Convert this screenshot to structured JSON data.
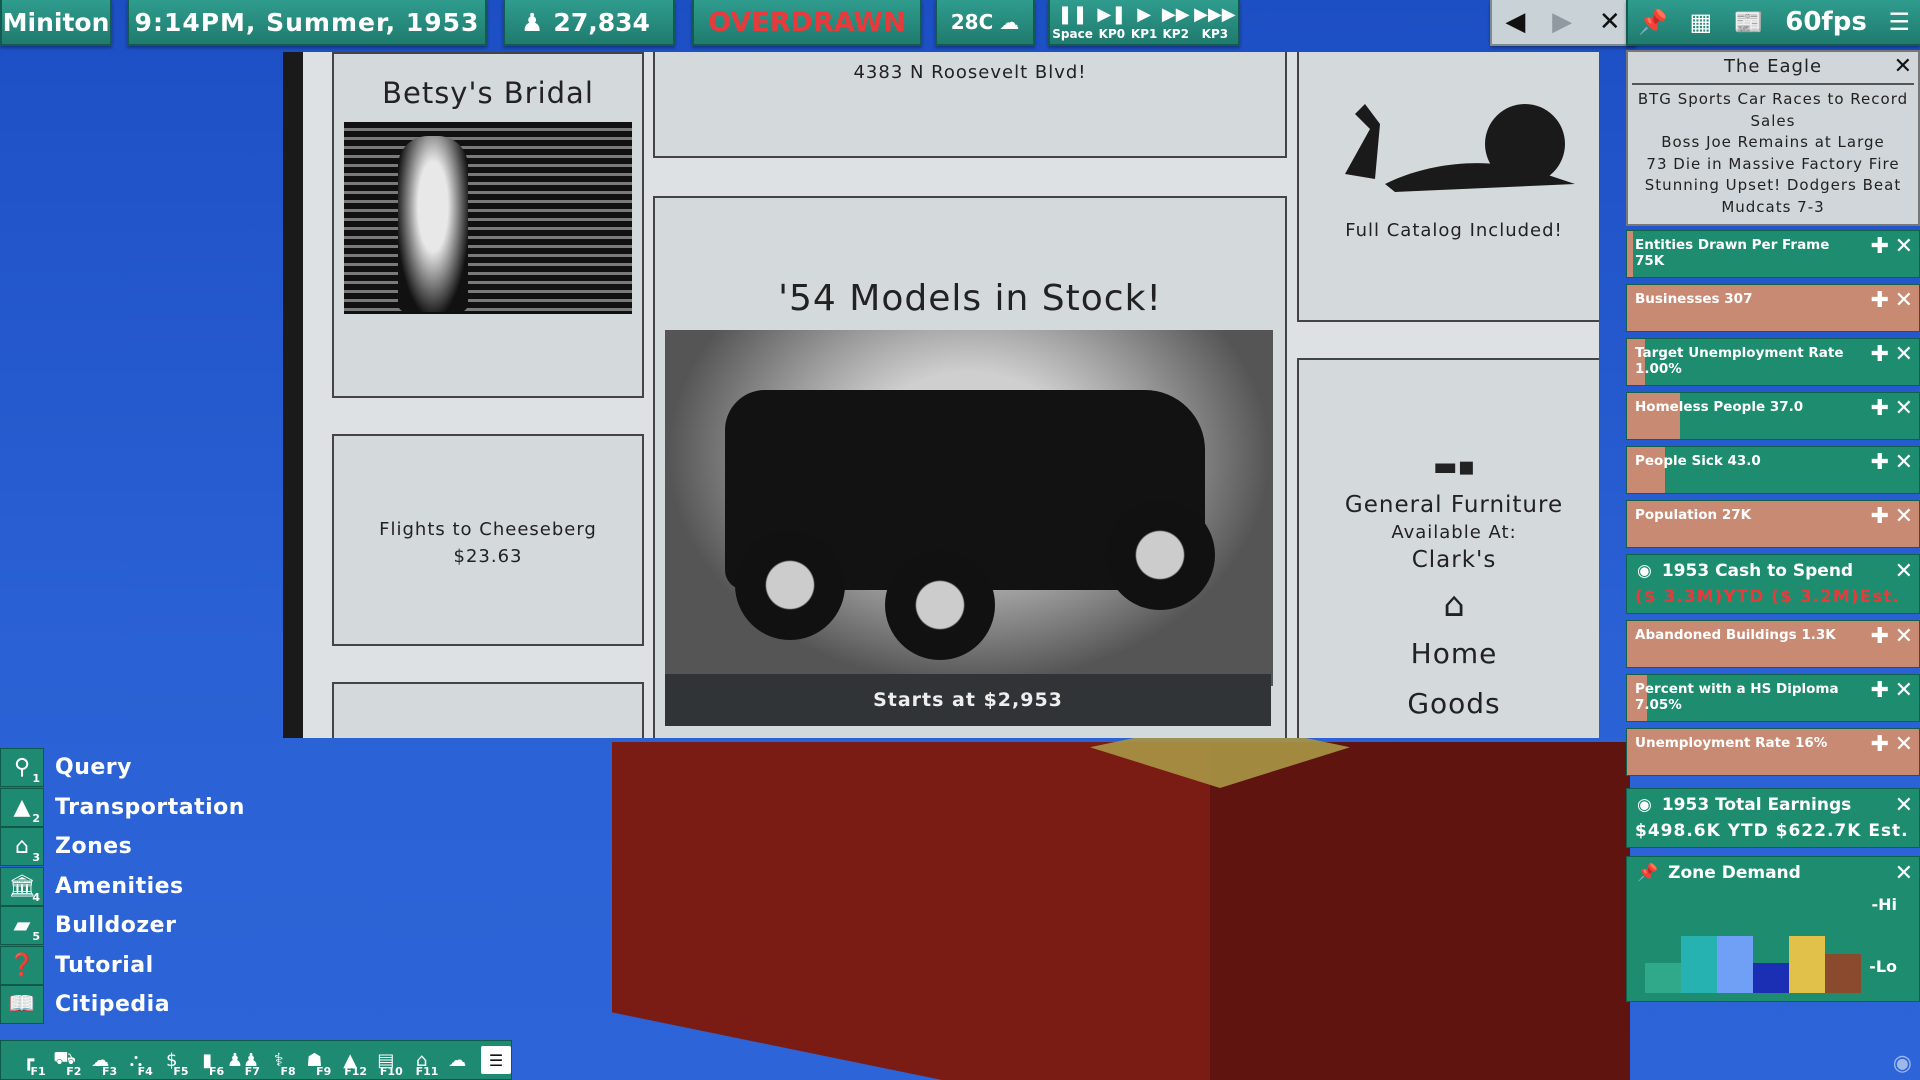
{
  "topbar": {
    "city": "Miniton",
    "datetime": "9:14PM, Summer, 1953",
    "population": "27,834",
    "money_status": "OVERDRAWN",
    "money_status_color": "#e83a3a",
    "temperature": "28C",
    "weather_icon": "rain-cloud-icon",
    "speed_controls": [
      {
        "label": "Space",
        "icon": "pause-icon"
      },
      {
        "label": "KP0",
        "icon": "play-slow-icon"
      },
      {
        "label": "KP1",
        "icon": "play-icon"
      },
      {
        "label": "KP2",
        "icon": "fast-forward-icon"
      },
      {
        "label": "KP3",
        "icon": "fastest-forward-icon"
      }
    ],
    "fps": "60fps"
  },
  "newspaper": {
    "bridal_title": "Betsy's Bridal",
    "flights_line1": "Flights to Cheeseberg",
    "flights_line2": "$23.63",
    "address": "4383 N Roosevelt Blvd!",
    "truck_headline": "'54 Models in Stock!",
    "truck_price": "Starts at $2,953",
    "catalog_text": "Full Catalog Included!",
    "furniture_line1": "General Furniture",
    "furniture_line2": "Available At:",
    "furniture_line3": "Clark's",
    "furniture_line4a": "Home",
    "furniture_line4b": "Goods"
  },
  "headlines": {
    "paper_name": "The Eagle",
    "items": [
      "BTG Sports Car Races to Record Sales",
      "Boss Joe Remains at Large",
      "73 Die in Massive Factory Fire",
      "Stunning Upset! Dodgers Beat Mudcats 7-3"
    ]
  },
  "stats": [
    {
      "label": "Entities Drawn Per Frame 75K",
      "fill": 0.02,
      "has_plus": true
    },
    {
      "label": "Businesses 307",
      "fill": 1.0,
      "has_plus": true
    },
    {
      "label": "Target Unemployment Rate 1.00%",
      "fill": 0.06,
      "has_plus": true
    },
    {
      "label": "Homeless People 37.0",
      "fill": 0.18,
      "has_plus": true
    },
    {
      "label": "People Sick 43.0",
      "fill": 0.13,
      "has_plus": true
    },
    {
      "label": "Population 27K",
      "fill": 1.0,
      "has_plus": true
    }
  ],
  "cash": {
    "title": "1953 Cash to Spend",
    "detail": "($ 3.3M)YTD ($ 3.2M)Est.",
    "detail_color": "#e83a3a"
  },
  "stats2": [
    {
      "label": "Abandoned Buildings 1.3K",
      "fill": 1.0,
      "has_plus": true
    },
    {
      "label": "Percent with a HS Diploma 7.05%",
      "fill": 0.07,
      "has_plus": true
    },
    {
      "label": "Unemployment Rate 16%",
      "fill": 1.0,
      "has_plus": true
    }
  ],
  "earnings": {
    "title": "1953 Total Earnings",
    "detail": "$498.6K YTD  $622.7K Est."
  },
  "zone_demand": {
    "title": "Zone Demand",
    "hi_label": "-Hi",
    "lo_label": "-Lo",
    "bars": [
      {
        "name": "residential",
        "value": 0.0,
        "color": "#2fa98a",
        "icon": "house-icon"
      },
      {
        "name": "apartments",
        "value": 0.45,
        "color": "#27b2b2",
        "icon": "apartment-icon"
      },
      {
        "name": "retail",
        "value": 0.45,
        "color": "#6fa0f5",
        "icon": "shop-icon"
      },
      {
        "name": "industrial",
        "value": 0.0,
        "color": "#1b2fb4",
        "icon": "factory-icon"
      },
      {
        "name": "farm",
        "value": 0.45,
        "color": "#e2c14a",
        "icon": "barn-icon"
      },
      {
        "name": "commercial",
        "value": 0.15,
        "color": "#8a4a2d",
        "icon": "store-icon"
      }
    ]
  },
  "toolmenu": [
    {
      "label": "Query",
      "num": "1",
      "icon": "magnifier-icon"
    },
    {
      "label": "Transportation",
      "num": "2",
      "icon": "road-icon"
    },
    {
      "label": "Zones",
      "num": "3",
      "icon": "zone-house-icon"
    },
    {
      "label": "Amenities",
      "num": "4",
      "icon": "civic-building-icon"
    },
    {
      "label": "Bulldozer",
      "num": "5",
      "icon": "bulldozer-icon"
    },
    {
      "label": "Tutorial",
      "num": "",
      "icon": "question-icon"
    },
    {
      "label": "Citipedia",
      "num": "",
      "icon": "book-icon"
    }
  ],
  "bottombar": [
    {
      "key": "F1",
      "icon": "road-overlay-icon"
    },
    {
      "key": "F2",
      "icon": "traffic-overlay-icon"
    },
    {
      "key": "F3",
      "icon": "pollution-overlay-icon"
    },
    {
      "key": "F4",
      "icon": "crime-overlay-icon"
    },
    {
      "key": "F5",
      "icon": "value-overlay-icon"
    },
    {
      "key": "F6",
      "icon": "density-overlay-icon"
    },
    {
      "key": "F7",
      "icon": "people-overlay-icon"
    },
    {
      "key": "F8",
      "icon": "health-overlay-icon"
    },
    {
      "key": "F9",
      "icon": "education-overlay-icon"
    },
    {
      "key": "F12",
      "icon": "transit-overlay-icon"
    },
    {
      "key": "F10",
      "icon": "zone-overlay-icon"
    },
    {
      "key": "F11",
      "icon": "housing-overlay-icon"
    },
    {
      "key": "",
      "icon": "weather-overlay-icon"
    }
  ]
}
